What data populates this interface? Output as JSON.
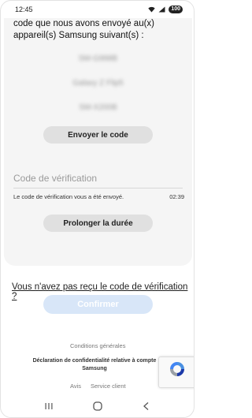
{
  "status_bar": {
    "time": "12:45",
    "battery": "100"
  },
  "verification": {
    "intro": "code que nous avons envoyé au(x) appareil(s) Samsung suivant(s) :",
    "devices": [
      "SM-G998B",
      "Galaxy Z Flip5",
      "SM-X200B"
    ],
    "send_code_label": "Envoyer le code",
    "code_placeholder": "Code de vérification",
    "sent_message": "Le code de vérification vous a été envoyé.",
    "timer": "02:39",
    "extend_label": "Prolonger la durée"
  },
  "resend_link": "Vous n'avez pas reçu le code de vérification ?",
  "confirm_label": "Confirmer",
  "footer": {
    "terms": "Conditions générales",
    "privacy": "Déclaration de confidentialité relative à compte Samsung",
    "notice": "Avis",
    "support": "Service client"
  },
  "colors": {
    "card_bg": "#f5f5f5",
    "pill_bg": "#e0e0e0",
    "confirm_bg": "#d8e6f8"
  },
  "icons": [
    "wifi-icon",
    "signal-icon",
    "recaptcha-icon",
    "recent-apps-icon",
    "home-icon",
    "back-icon"
  ]
}
